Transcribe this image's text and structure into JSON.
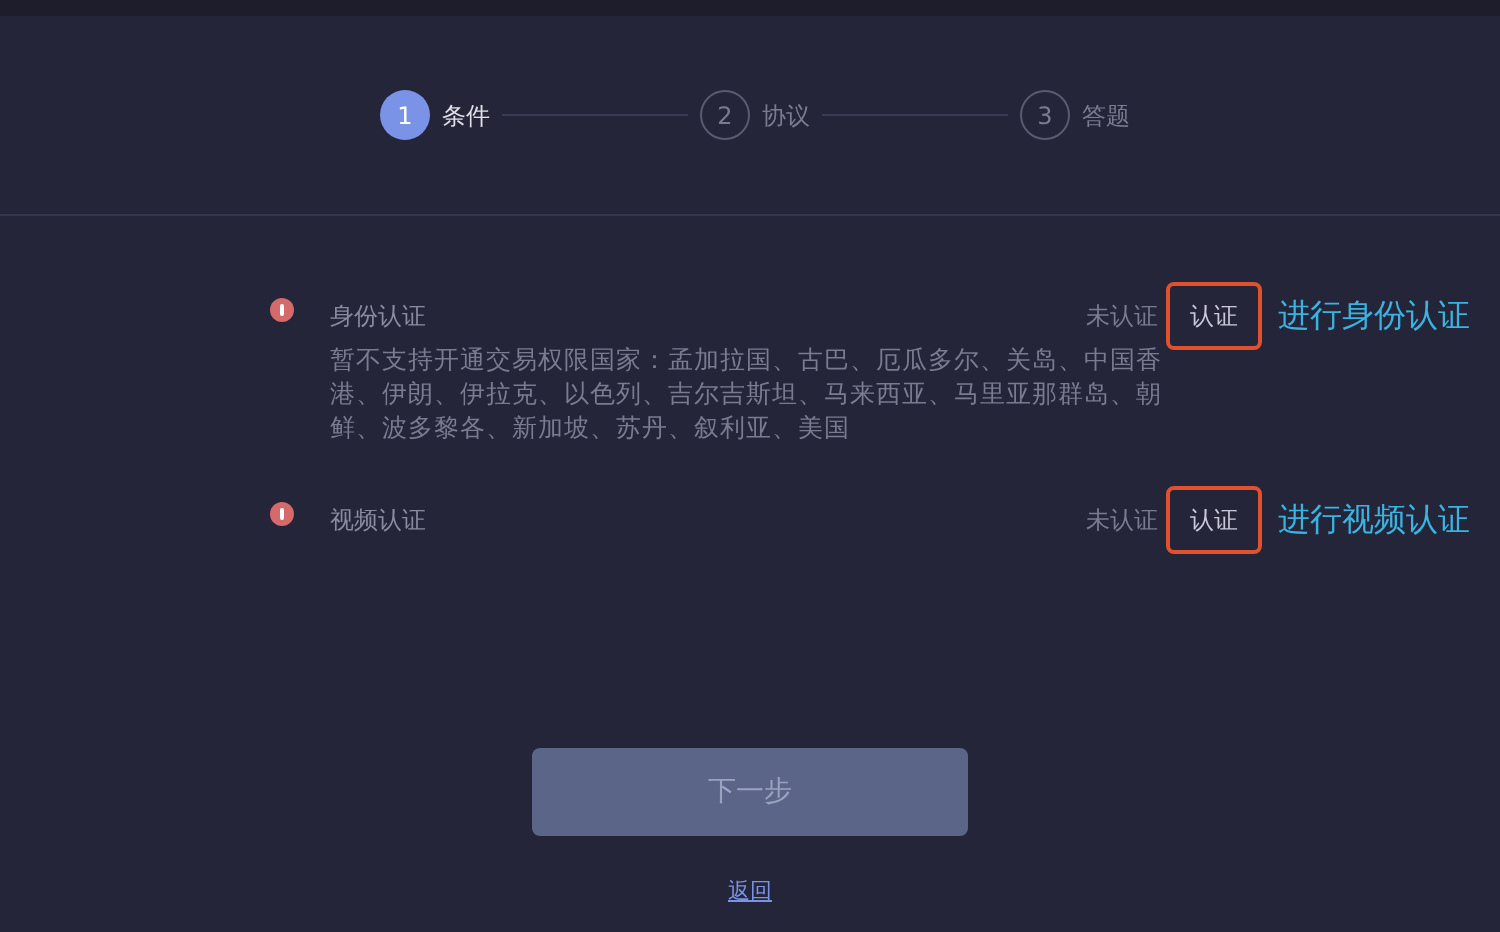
{
  "steps": [
    {
      "number": "1",
      "label": "条件",
      "selected": true
    },
    {
      "number": "2",
      "label": "协议",
      "selected": false
    },
    {
      "number": "3",
      "label": "答题",
      "selected": false
    }
  ],
  "requirements": [
    {
      "title": "身份认证",
      "description": "暂不支持开通交易权限国家：孟加拉国、古巴、厄瓜多尔、关岛、中国香港、伊朗、伊拉克、以色列、吉尔吉斯坦、马来西亚、马里亚那群岛、朝鲜、波多黎各、新加坡、苏丹、叙利亚、美国",
      "status": "未认证",
      "action": "认证",
      "annotation": "进行身份认证"
    },
    {
      "title": "视频认证",
      "status": "未认证",
      "action": "认证",
      "annotation": "进行视频认证"
    }
  ],
  "next_button": "下一步",
  "back_link": "返回"
}
